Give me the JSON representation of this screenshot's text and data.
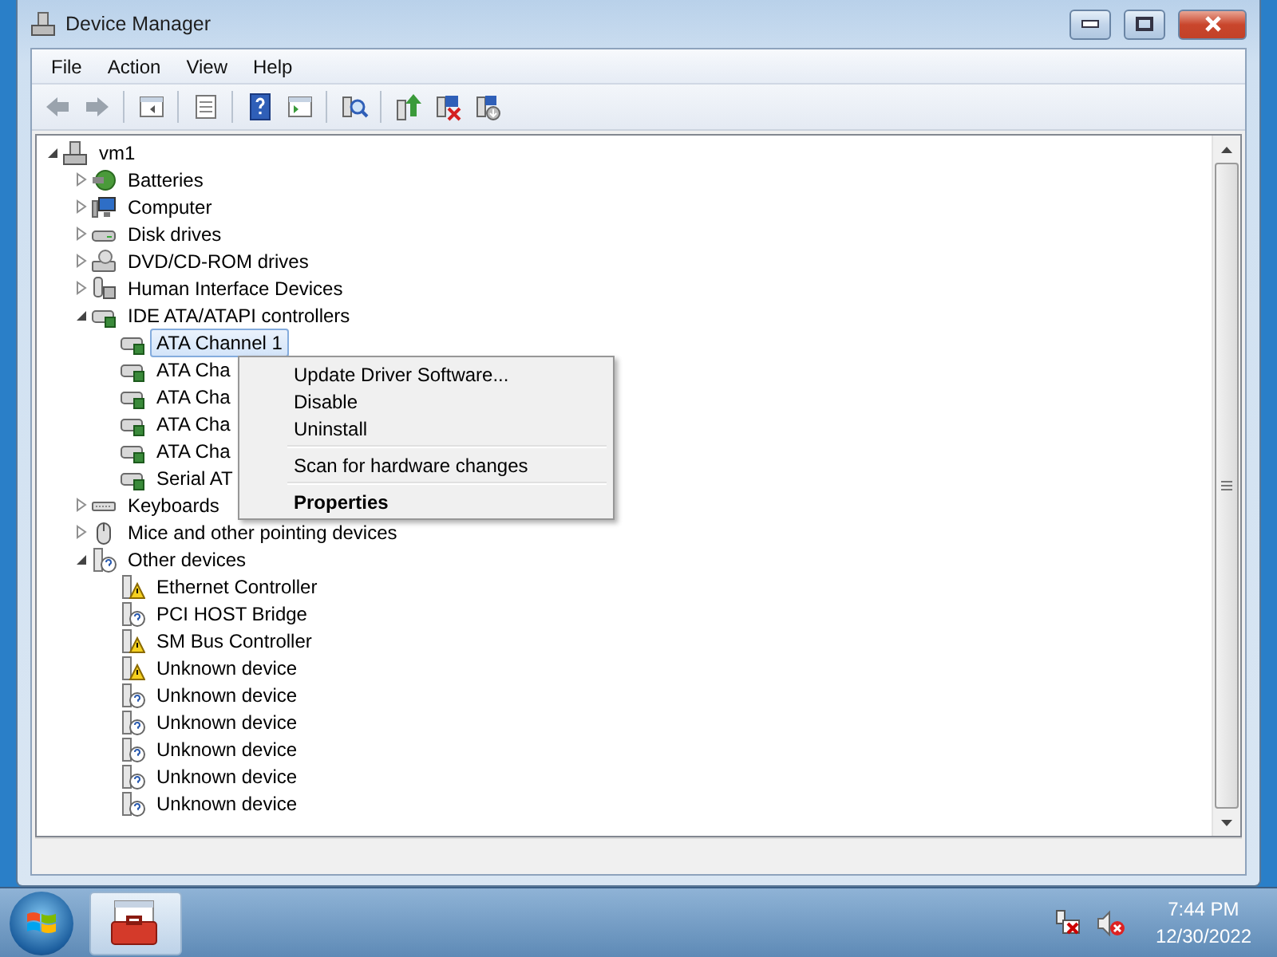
{
  "window": {
    "title": "Device Manager"
  },
  "menu": [
    "File",
    "Action",
    "View",
    "Help"
  ],
  "toolbar": [
    {
      "kind": "back",
      "disabled": true
    },
    {
      "kind": "forward",
      "disabled": true
    },
    {
      "kind": "sep"
    },
    {
      "kind": "tree-pane"
    },
    {
      "kind": "sep"
    },
    {
      "kind": "properties"
    },
    {
      "kind": "sep"
    },
    {
      "kind": "help"
    },
    {
      "kind": "action-pane"
    },
    {
      "kind": "sep"
    },
    {
      "kind": "scan"
    },
    {
      "kind": "sep"
    },
    {
      "kind": "update"
    },
    {
      "kind": "uninstall"
    },
    {
      "kind": "disable"
    }
  ],
  "tree": [
    {
      "label": "vm1",
      "kind": "computer",
      "expanded": true,
      "selected": false,
      "children": [
        {
          "label": "Batteries",
          "kind": "battery",
          "expanded": false,
          "selected": false
        },
        {
          "label": "Computer",
          "kind": "monitor",
          "expanded": false,
          "selected": false
        },
        {
          "label": "Disk drives",
          "kind": "disk",
          "expanded": false,
          "selected": false
        },
        {
          "label": "DVD/CD-ROM drives",
          "kind": "optical",
          "expanded": false,
          "selected": false
        },
        {
          "label": "Human Interface Devices",
          "kind": "hid",
          "expanded": false,
          "selected": false
        },
        {
          "label": "IDE ATA/ATAPI controllers",
          "kind": "controller",
          "expanded": true,
          "selected": false,
          "children": [
            {
              "label": "ATA Channel 1",
              "kind": "controller",
              "selected": true
            },
            {
              "label": "ATA Cha",
              "kind": "controller",
              "selected": false
            },
            {
              "label": "ATA Cha",
              "kind": "controller",
              "selected": false
            },
            {
              "label": "ATA Cha",
              "kind": "controller",
              "selected": false
            },
            {
              "label": "ATA Cha",
              "kind": "controller",
              "selected": false
            },
            {
              "label": "Serial AT",
              "kind": "controller",
              "selected": false
            }
          ]
        },
        {
          "label": "Keyboards",
          "kind": "keyboard",
          "expanded": false,
          "selected": false
        },
        {
          "label": "Mice and other pointing devices",
          "kind": "mouse",
          "expanded": false,
          "selected": false
        },
        {
          "label": "Other devices",
          "kind": "unknown",
          "expanded": true,
          "selected": false,
          "children": [
            {
              "label": "Ethernet Controller",
              "kind": "warning",
              "selected": false
            },
            {
              "label": "PCI HOST Bridge",
              "kind": "unknown",
              "selected": false
            },
            {
              "label": "SM Bus Controller",
              "kind": "warning",
              "selected": false
            },
            {
              "label": "Unknown device",
              "kind": "warning",
              "selected": false
            },
            {
              "label": "Unknown device",
              "kind": "unknown",
              "selected": false
            },
            {
              "label": "Unknown device",
              "kind": "unknown",
              "selected": false
            },
            {
              "label": "Unknown device",
              "kind": "unknown",
              "selected": false
            },
            {
              "label": "Unknown device",
              "kind": "unknown",
              "selected": false
            },
            {
              "label": "Unknown device",
              "kind": "unknown",
              "selected": false
            }
          ]
        }
      ]
    }
  ],
  "context_menu": [
    {
      "kind": "item",
      "label": "Update Driver Software...",
      "default": false
    },
    {
      "kind": "item",
      "label": "Disable",
      "default": false
    },
    {
      "kind": "item",
      "label": "Uninstall",
      "default": false
    },
    {
      "kind": "separator"
    },
    {
      "kind": "item",
      "label": "Scan for hardware changes",
      "default": false
    },
    {
      "kind": "separator"
    },
    {
      "kind": "item",
      "label": "Properties",
      "default": true
    }
  ],
  "taskbar": {
    "clock_time": "7:44 PM",
    "clock_date": "12/30/2022"
  }
}
